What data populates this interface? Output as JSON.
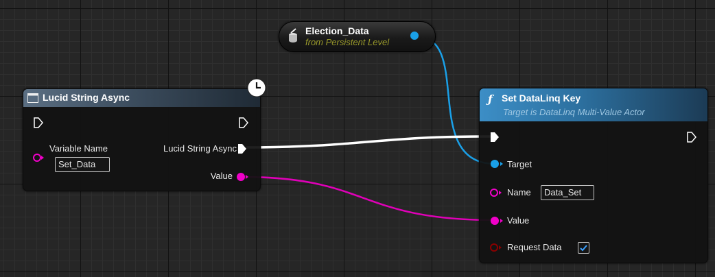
{
  "variable_node": {
    "name": "Election_Data",
    "subtitle": "from Persistent Level"
  },
  "async_node": {
    "title": "Lucid String Async",
    "input_label": "Variable Name",
    "input_value": "Set_Data",
    "output_exec_label": "Lucid String Async",
    "output_value_label": "Value"
  },
  "set_node": {
    "title": "Set DataLinq Key",
    "subtitle": "Target is DataLinq Multi-Value Actor",
    "target_label": "Target",
    "name_label": "Name",
    "name_value": "Data_Set",
    "value_label": "Value",
    "request_label": "Request Data",
    "request_checked": true
  },
  "icons": [
    "clock-icon",
    "variable-icon",
    "function-icon",
    "node-icon",
    "checkmark-icon"
  ],
  "colors": {
    "object_pin": "#1aa0e8",
    "string_pin": "#f000c8",
    "bool_pin": "#8a0000",
    "exec_pin": "#ffffff",
    "function_header": "#3c8ec6",
    "async_header": "#5b6f83",
    "background": "#262626"
  }
}
